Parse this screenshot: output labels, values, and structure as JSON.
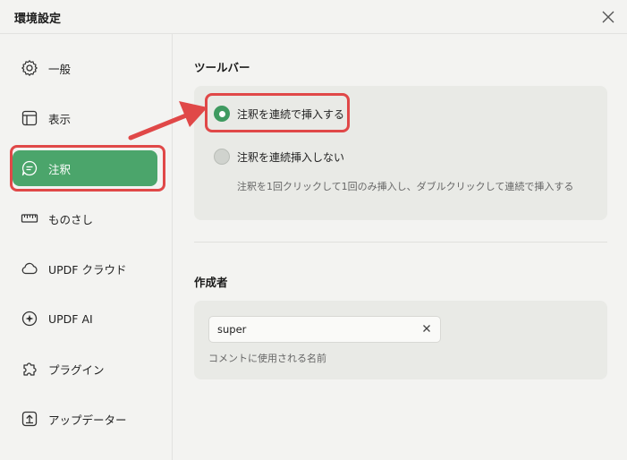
{
  "window": {
    "title": "環境設定"
  },
  "sidebar": {
    "items": [
      {
        "label": "一般",
        "icon": "gear-icon"
      },
      {
        "label": "表示",
        "icon": "layout-icon"
      },
      {
        "label": "注釈",
        "icon": "comment-icon",
        "active": true
      },
      {
        "label": "ものさし",
        "icon": "ruler-icon"
      },
      {
        "label": "UPDF クラウド",
        "icon": "cloud-icon"
      },
      {
        "label": "UPDF AI",
        "icon": "ai-icon"
      },
      {
        "label": "プラグイン",
        "icon": "puzzle-icon"
      },
      {
        "label": "アップデーター",
        "icon": "update-icon"
      }
    ]
  },
  "toolbar_section": {
    "title": "ツールバー",
    "options": [
      {
        "label": "注釈を連続で挿入する",
        "selected": true
      },
      {
        "label": "注釈を連続挿入しない",
        "selected": false
      }
    ],
    "description": "注釈を1回クリックして1回のみ挿入し、ダブルクリックして連続で挿入する"
  },
  "author_section": {
    "title": "作成者",
    "input_value": "super",
    "hint": "コメントに使用される名前"
  },
  "colors": {
    "accent": "#4ba56b",
    "highlight": "#e04848"
  }
}
